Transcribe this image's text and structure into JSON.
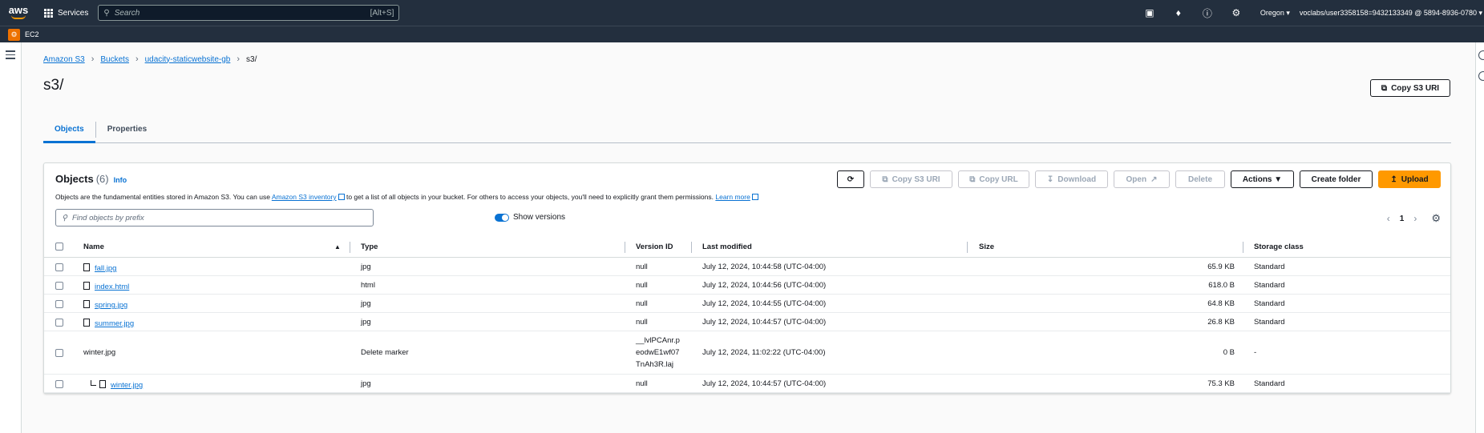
{
  "topnav": {
    "logo": "aws",
    "services_label": "Services",
    "search_placeholder": "Search",
    "search_shortcut": "[Alt+S]",
    "region": "Oregon ▾",
    "account": "voclabs/user3358158=9432133349 @ 5894-8936-0780 ▾"
  },
  "subbar": {
    "service": "EC2"
  },
  "breadcrumb": {
    "items": [
      "Amazon S3",
      "Buckets",
      "udacity-staticwebsite-gb"
    ],
    "current": "s3/"
  },
  "page": {
    "title": "s3/",
    "copy_uri_label": "Copy S3 URI"
  },
  "tabs": [
    "Objects",
    "Properties"
  ],
  "panel": {
    "title": "Objects",
    "count": "(6)",
    "info": "Info",
    "desc_before": "Objects are the fundamental entities stored in Amazon S3. You can use ",
    "desc_link1": "Amazon S3 inventory",
    "desc_middle": " to get a list of all objects in your bucket. For others to access your objects, you'll need to explicitly grant them permissions. ",
    "desc_link2": "Learn more",
    "filter_placeholder": "Find objects by prefix",
    "show_versions": "Show versions",
    "page_number": "1"
  },
  "toolbar": {
    "copy_s3_uri": "Copy S3 URI",
    "copy_url": "Copy URL",
    "download": "Download",
    "open": "Open",
    "delete": "Delete",
    "actions": "Actions ▼",
    "create_folder": "Create folder",
    "upload": "Upload"
  },
  "table": {
    "columns": [
      "Name",
      "Type",
      "Version ID",
      "Last modified",
      "Size",
      "Storage class"
    ],
    "rows": [
      {
        "name": "fall.jpg",
        "type": "jpg",
        "version": "null",
        "modified": "July 12, 2024, 10:44:58 (UTC-04:00)",
        "size": "65.9 KB",
        "class": "Standard"
      },
      {
        "name": "index.html",
        "type": "html",
        "version": "null",
        "modified": "July 12, 2024, 10:44:56 (UTC-04:00)",
        "size": "618.0 B",
        "class": "Standard"
      },
      {
        "name": "spring.jpg",
        "type": "jpg",
        "version": "null",
        "modified": "July 12, 2024, 10:44:55 (UTC-04:00)",
        "size": "64.8 KB",
        "class": "Standard"
      },
      {
        "name": "summer.jpg",
        "type": "jpg",
        "version": "null",
        "modified": "July 12, 2024, 10:44:57 (UTC-04:00)",
        "size": "26.8 KB",
        "class": "Standard"
      },
      {
        "name": "winter.jpg",
        "type": "Delete marker",
        "version": "__lvlPCAnr.peodwE1wf07TnAh3R.laj",
        "modified": "July 12, 2024, 11:02:22 (UTC-04:00)",
        "size": "0 B",
        "class": "-"
      },
      {
        "name": "winter.jpg",
        "type": "jpg",
        "version": "null",
        "modified": "July 12, 2024, 10:44:57 (UTC-04:00)",
        "size": "75.3 KB",
        "class": "Standard"
      }
    ]
  }
}
